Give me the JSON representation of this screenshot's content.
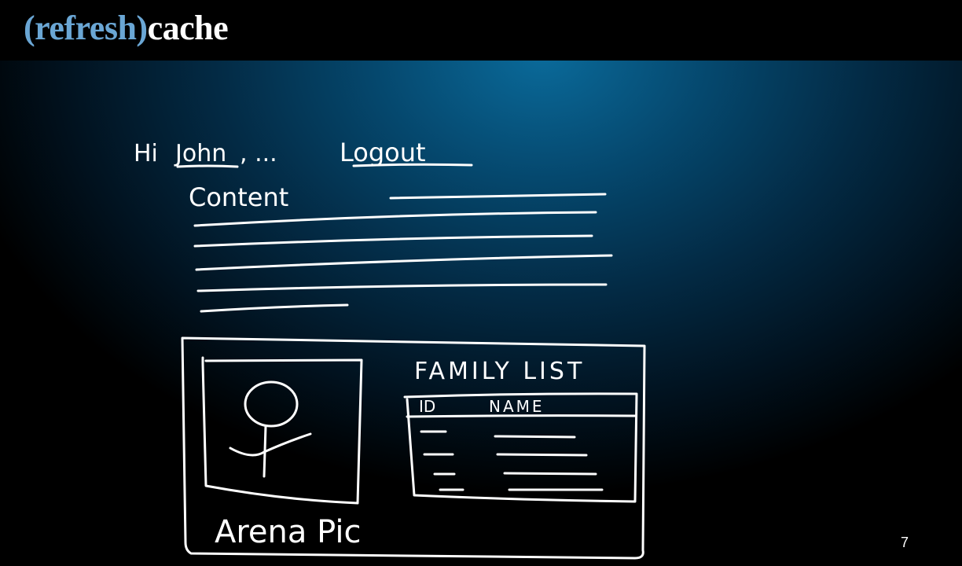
{
  "title": {
    "part1": "(refresh)",
    "part2": "cache"
  },
  "sketch": {
    "greeting": "Hi",
    "user_name": "John",
    "ellipsis": ", ...",
    "logout": "Logout",
    "content_heading": "Content",
    "picture_caption": "Arena Pic",
    "family_list_title": "FAMILY LIST",
    "family_list_columns": [
      "ID",
      "NAME"
    ]
  },
  "page_number": "7",
  "colors": {
    "title_accent": "#6aa6d4",
    "title_main": "#ffffff",
    "ink": "#ffffff",
    "titlebar": "#000000"
  }
}
